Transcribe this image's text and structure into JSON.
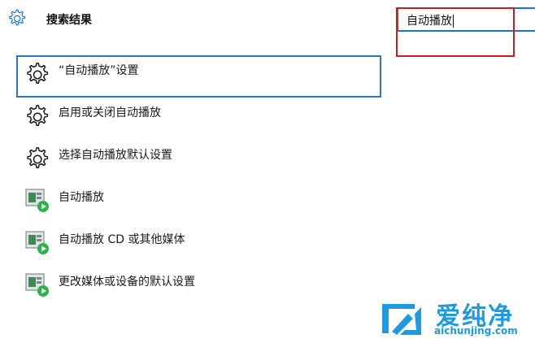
{
  "header": {
    "title": "搜索结果",
    "icon": "gear-icon"
  },
  "search": {
    "value": "自动播放",
    "accent": "#1e73d8"
  },
  "annotation": {
    "color": "#d01c1c"
  },
  "results": [
    {
      "label": "“自动播放”设置",
      "icon": "gear-icon",
      "selected": true
    },
    {
      "label": "启用或关闭自动播放",
      "icon": "gear-icon",
      "selected": false
    },
    {
      "label": "选择自动播放默认设置",
      "icon": "gear-icon",
      "selected": false
    },
    {
      "label": "自动播放",
      "icon": "autoplay-media-icon",
      "selected": false
    },
    {
      "label": "自动播放 CD 或其他媒体",
      "icon": "autoplay-media-icon",
      "selected": false
    },
    {
      "label": "更改媒体或设备的默认设置",
      "icon": "autoplay-media-icon",
      "selected": false
    }
  ],
  "watermark": {
    "brand": "爱纯净",
    "url": "aichunjing.com",
    "color": "#1d9be0"
  }
}
